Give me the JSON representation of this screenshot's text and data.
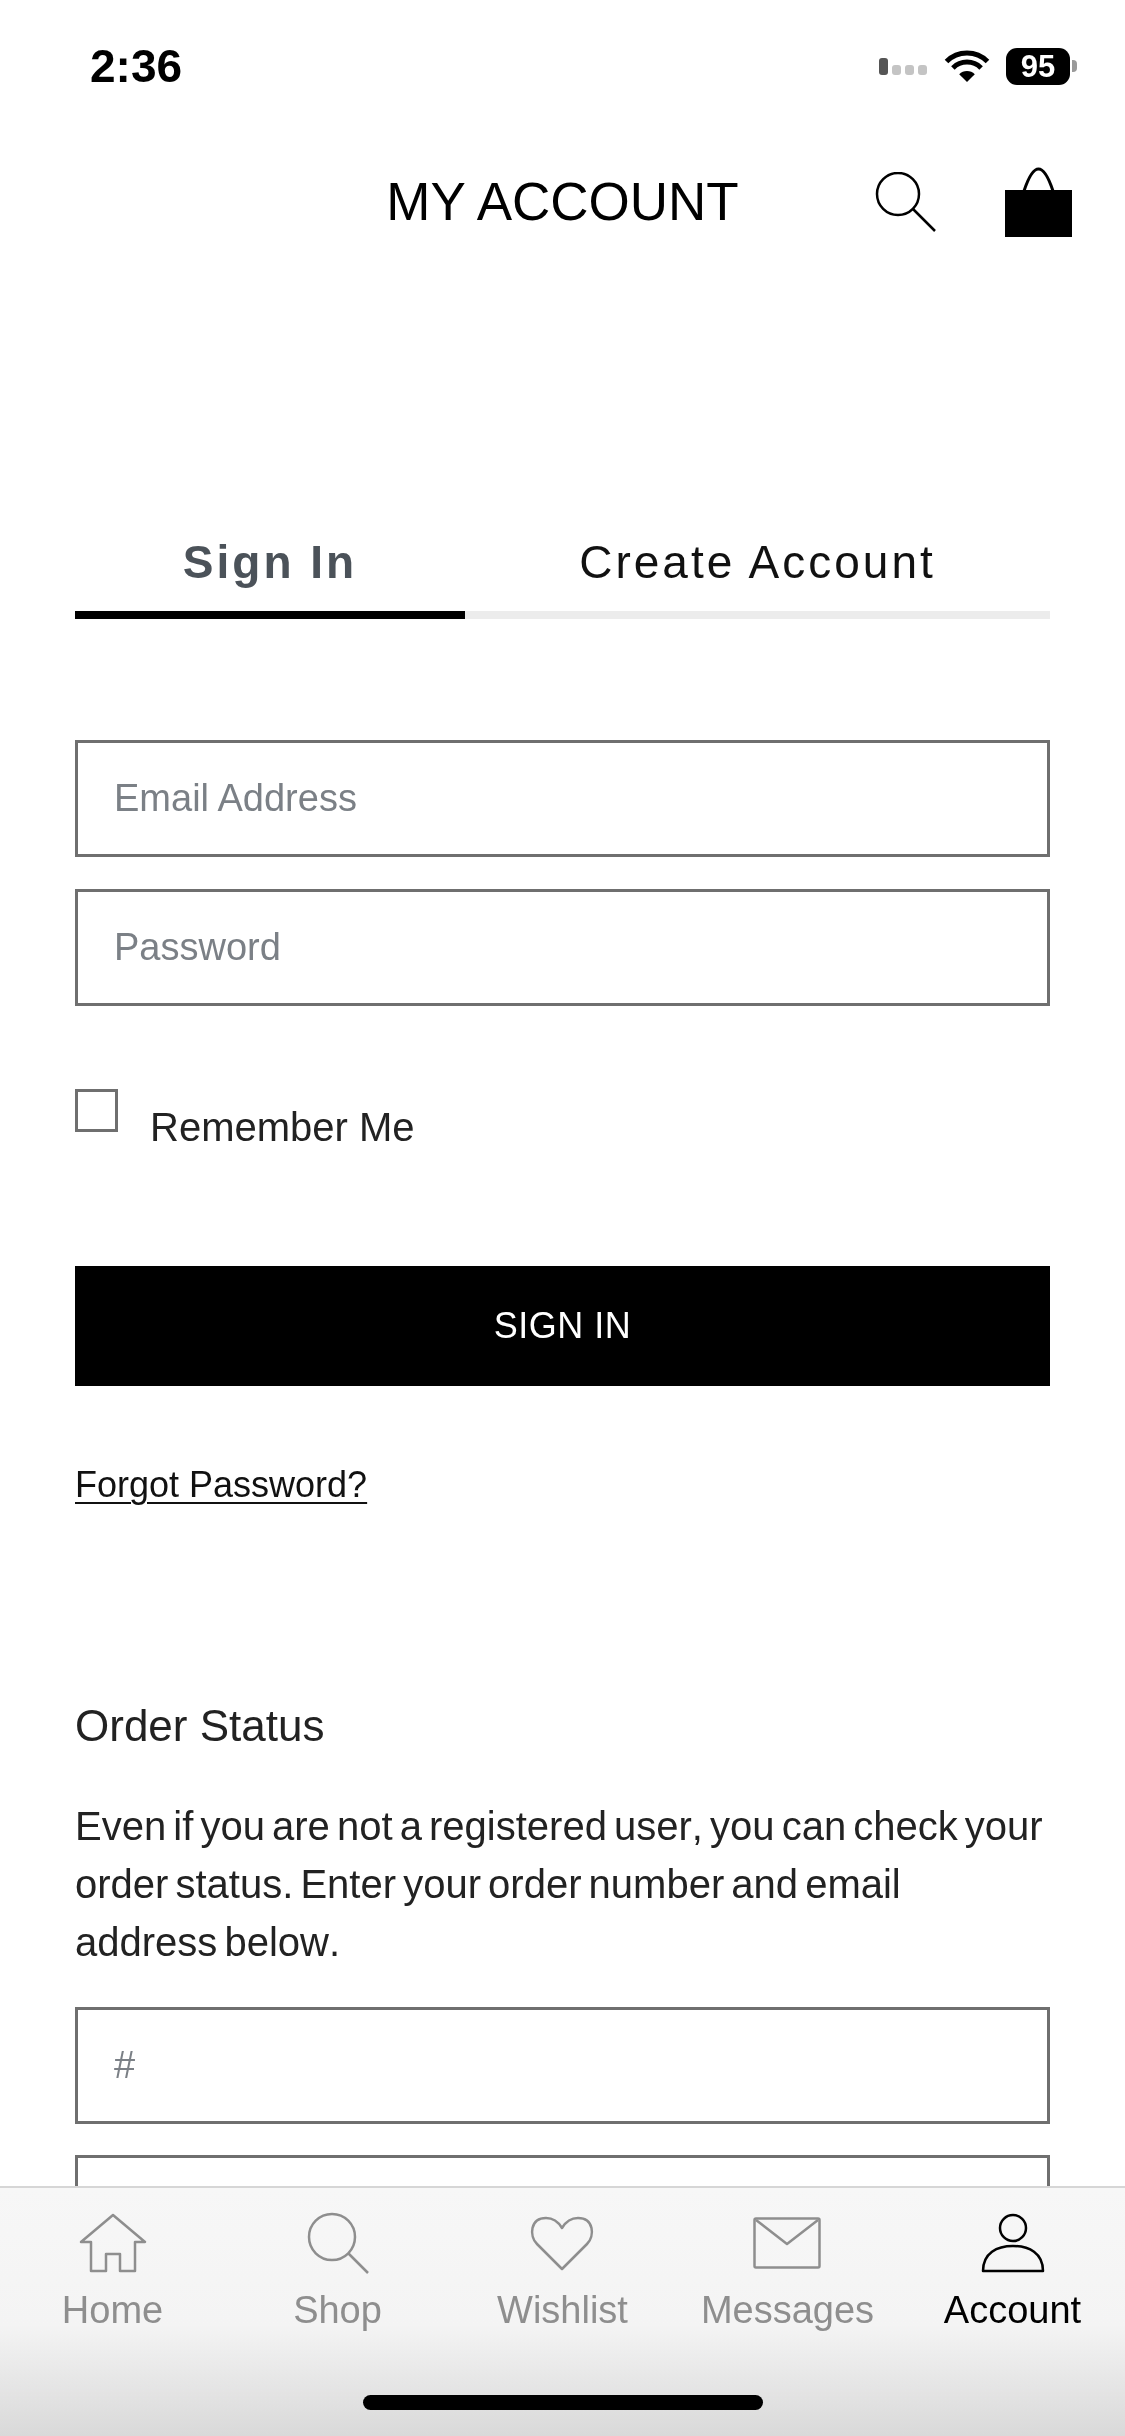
{
  "status_bar": {
    "time": "2:36",
    "battery": "95"
  },
  "header": {
    "title": "MY ACCOUNT"
  },
  "tabs": [
    {
      "label": "Sign In",
      "selected": true
    },
    {
      "label": "Create Account",
      "selected": false
    }
  ],
  "sign_in": {
    "fields": [
      {
        "placeholder": "Email Address"
      },
      {
        "placeholder": "Password"
      }
    ],
    "remember_me": {
      "label": "Remember Me",
      "checked": false
    },
    "button": "SIGN IN",
    "forgot_password": "Forgot Password?"
  },
  "order_status": {
    "title": "Order Status",
    "description": "Even if you are not a registered user, you can check your order status. Enter your order number and email address below.",
    "fields": [
      {
        "placeholder": "#"
      }
    ]
  },
  "tab_bar": [
    {
      "label": "Home",
      "selected": false
    },
    {
      "label": "Shop",
      "selected": false
    },
    {
      "label": "Wishlist",
      "selected": false
    },
    {
      "label": "Messages",
      "selected": false
    },
    {
      "label": "Account",
      "selected": true
    }
  ]
}
